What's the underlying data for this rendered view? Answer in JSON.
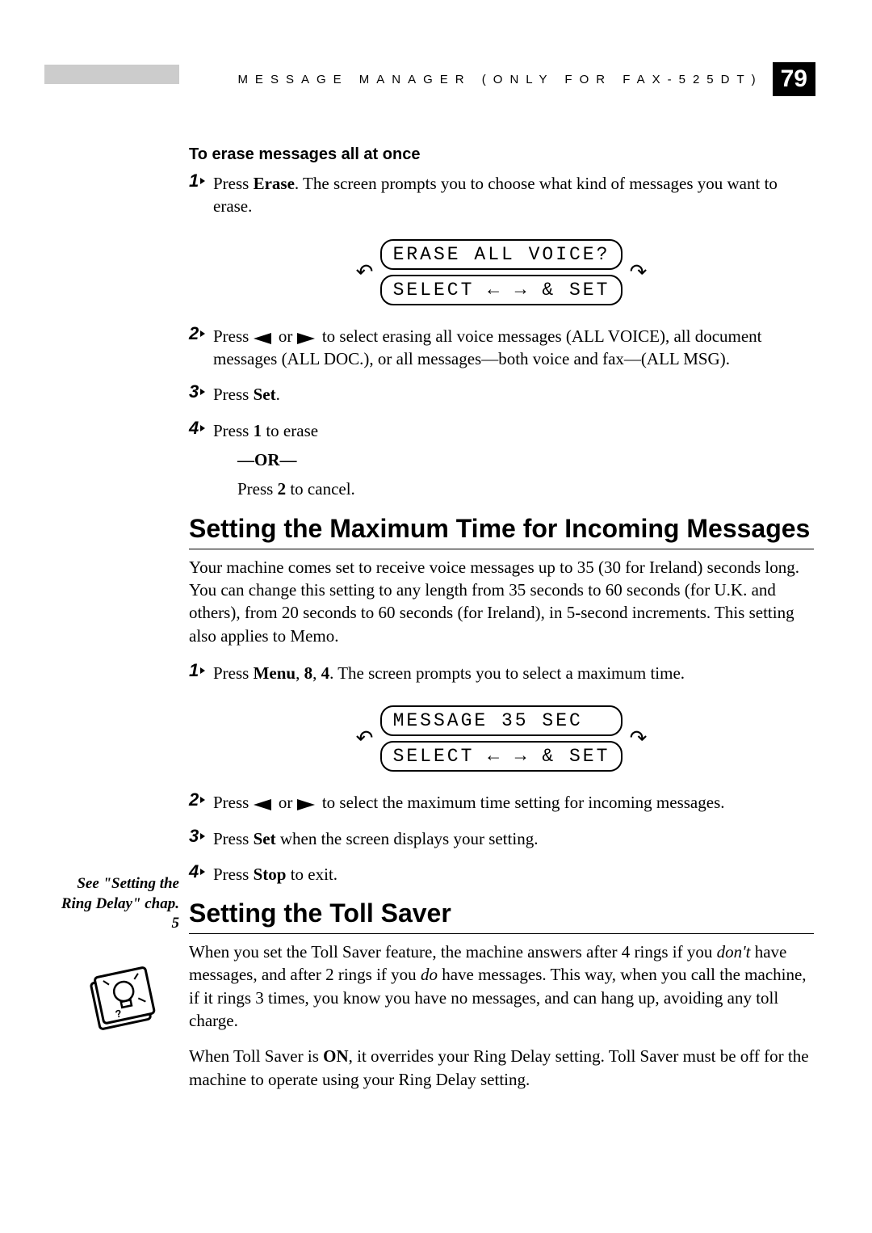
{
  "header": {
    "title": "MESSAGE MANAGER (ONLY FOR FAX-525DT)",
    "page_number": "79"
  },
  "section_erase": {
    "subheading": "To erase messages all at once",
    "steps": [
      {
        "n": "1",
        "pre": "Press ",
        "bold": "Erase",
        "post": ". The screen prompts you to choose what kind of messages you want to erase."
      },
      {
        "n": "2",
        "text": " to select erasing all voice messages (ALL VOICE), all document messages (ALL DOC.), or all messages—both voice and fax—(ALL MSG)."
      },
      {
        "n": "3",
        "pre": "Press ",
        "bold": "Set",
        "post": "."
      },
      {
        "n": "4",
        "pre": "Press ",
        "bold": "1",
        "post": " to erase"
      }
    ],
    "lcd": {
      "line1": "ERASE ALL VOICE?",
      "line2": "SELECT ← → & SET"
    },
    "or": "—OR—",
    "cancel_pre": "Press ",
    "cancel_bold": "2",
    "cancel_post": " to cancel."
  },
  "section_maxtime": {
    "heading": "Setting the Maximum Time for Incoming Messages",
    "body": "Your machine comes set to receive voice messages up to 35 (30 for Ireland) seconds long. You can change this setting to any length from 35 seconds to 60 seconds (for U.K. and others), from 20 seconds to 60 seconds (for Ireland), in 5-second increments. This setting also applies to Memo.",
    "steps": [
      {
        "n": "1",
        "pre": "Press ",
        "bold": "Menu",
        "mid1": ", ",
        "bold2": "8",
        "mid2": ", ",
        "bold3": "4",
        "post": ". The screen prompts you to select a maximum time."
      },
      {
        "n": "2",
        "text": " to select the maximum time setting for incoming messages."
      },
      {
        "n": "3",
        "pre": "Press ",
        "bold": "Set",
        "post": " when the screen displays your setting."
      },
      {
        "n": "4",
        "pre": "Press ",
        "bold": "Stop",
        "post": " to exit."
      }
    ],
    "lcd": {
      "line1": "MESSAGE 35 SEC  ",
      "line2": "SELECT ← → & SET"
    }
  },
  "section_tollsaver": {
    "heading": "Setting the Toll Saver",
    "sidebar": "See \"Setting the Ring Delay\" chap. 5",
    "p1_a": "When you set the Toll Saver feature, the machine answers after 4 rings if you ",
    "p1_dont": "don't",
    "p1_b": " have messages, and after 2 rings if you ",
    "p1_do": "do",
    "p1_c": " have messages. This way, when you call the machine, if it rings 3 times, you know you have no messages, and can hang up, avoiding any toll charge.",
    "p2_a": "When Toll Saver is ",
    "p2_on": "ON",
    "p2_b": ", it overrides your Ring Delay setting. Toll Saver must be off for the machine to operate using your Ring Delay setting."
  },
  "glyphs": {
    "press_prefix": "Press ",
    "or_word": " or "
  }
}
